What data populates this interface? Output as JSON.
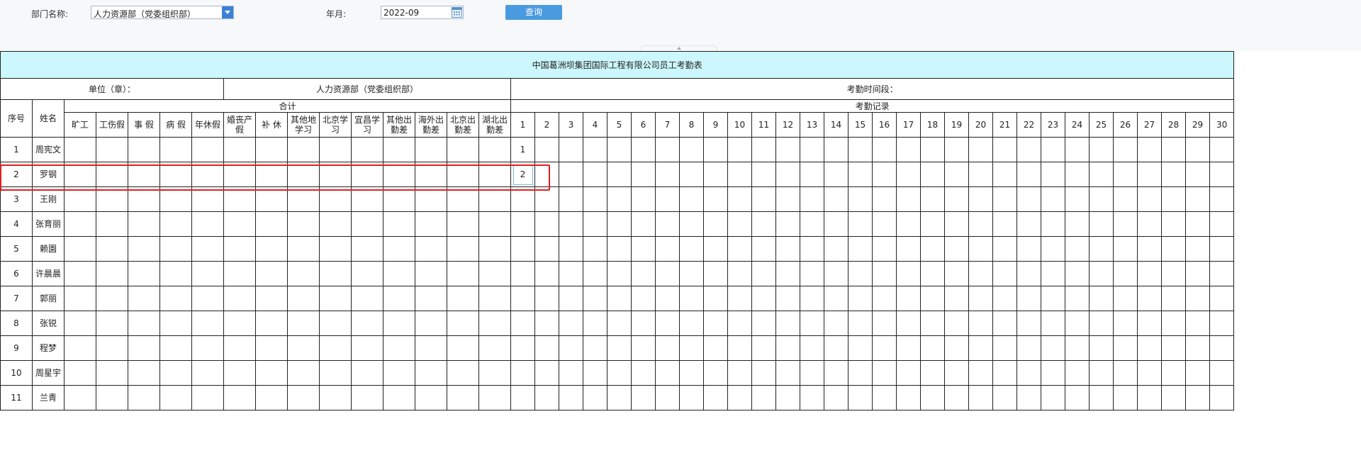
{
  "filters": {
    "dept_label": "部门名称:",
    "dept_value": "人力资源部（党委组织部）",
    "ym_label": "年月:",
    "ym_value": "2022-09",
    "query_label": "查询"
  },
  "table": {
    "title": "中国葛洲坝集团国际工程有限公司员工考勤表",
    "unit_label": "单位（章）：",
    "unit_value": "人力资源部（党委组织部）",
    "period_label": "考勤时间段：",
    "col_seq": "序号",
    "col_name": "姓名",
    "summary_label": "合计",
    "records_label": "考勤记录",
    "leave_types": [
      "旷工",
      "工伤假",
      "事 假",
      "病 假",
      "年休假",
      "婚丧产假",
      "补 休",
      "其他地学习",
      "北京学习",
      "宜昌学习",
      "其他出勤差",
      "海外出勤差",
      "北京出勤差",
      "湖北出勤差"
    ],
    "days": [
      "1",
      "2",
      "3",
      "4",
      "5",
      "6",
      "7",
      "8",
      "9",
      "10",
      "11",
      "12",
      "13",
      "14",
      "15",
      "16",
      "17",
      "18",
      "19",
      "20",
      "21",
      "22",
      "23",
      "24",
      "25",
      "26",
      "27",
      "28",
      "29",
      "30"
    ],
    "rows": [
      {
        "seq": "1",
        "name": "周宪文",
        "day1": "1"
      },
      {
        "seq": "2",
        "name": "罗钢",
        "day1": "2"
      },
      {
        "seq": "3",
        "name": "王刚",
        "day1": ""
      },
      {
        "seq": "4",
        "name": "张育丽",
        "day1": ""
      },
      {
        "seq": "5",
        "name": "赖園",
        "day1": ""
      },
      {
        "seq": "6",
        "name": "许晨晨",
        "day1": ""
      },
      {
        "seq": "7",
        "name": "郭丽",
        "day1": ""
      },
      {
        "seq": "8",
        "name": "张锐",
        "day1": ""
      },
      {
        "seq": "9",
        "name": "程梦",
        "day1": ""
      },
      {
        "seq": "10",
        "name": "周星宇",
        "day1": ""
      },
      {
        "seq": "11",
        "name": "兰青",
        "day1": ""
      }
    ]
  }
}
